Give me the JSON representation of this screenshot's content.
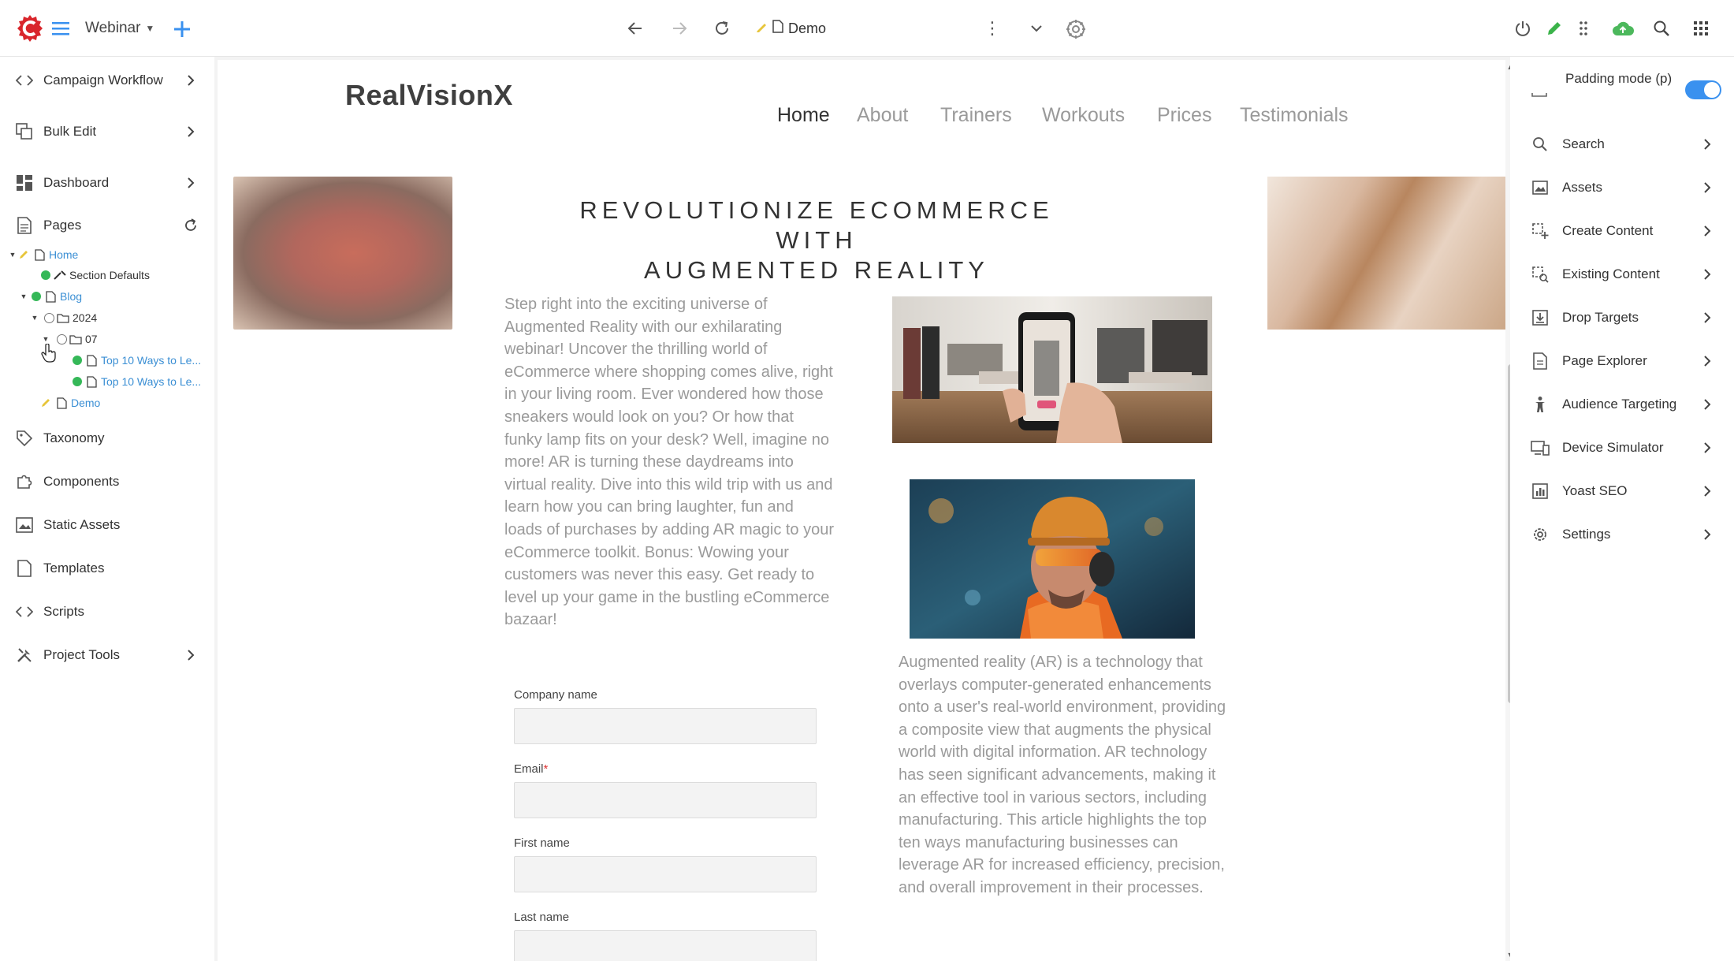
{
  "topbar": {
    "site_name": "Webinar",
    "url_page": "Demo",
    "url_more": "⋮"
  },
  "sidebar": {
    "items": [
      {
        "label": "Campaign Workflow"
      },
      {
        "label": "Bulk Edit"
      },
      {
        "label": "Dashboard"
      },
      {
        "label": "Pages"
      },
      {
        "label": "Taxonomy"
      },
      {
        "label": "Components"
      },
      {
        "label": "Static Assets"
      },
      {
        "label": "Templates"
      },
      {
        "label": "Scripts"
      },
      {
        "label": "Project Tools"
      }
    ],
    "tree": [
      {
        "label": "Home"
      },
      {
        "label": "Section Defaults"
      },
      {
        "label": "Blog"
      },
      {
        "label": "2024"
      },
      {
        "label": "07"
      },
      {
        "label": "Top 10 Ways to Le..."
      },
      {
        "label": "Top 10 Ways to Le..."
      },
      {
        "label": "Demo"
      }
    ]
  },
  "site": {
    "brand": "RealVisionX",
    "nav": [
      "Home",
      "About",
      "Trainers",
      "Workouts",
      "Prices",
      "Testimonials"
    ],
    "hero_title_line1": "REVOLUTIONIZE ECOMMERCE WITH",
    "hero_title_line2": "AUGMENTED REALITY",
    "intro_text": "Step right into the exciting universe of Augmented Reality with our exhilarating webinar! Uncover the thrilling world of eCommerce where shopping comes alive, right in your living room. Ever wondered how those sneakers would look on you? Or how that funky lamp fits on your desk? Well, imagine no more! AR is turning these daydreams into virtual reality. Dive into this wild trip with us and learn how you can bring laughter, fun and loads of purchases by adding AR magic to your eCommerce toolkit. Bonus: Wowing your customers was never this easy. Get ready to level up your game in the bustling eCommerce bazaar!",
    "ar_text": "Augmented reality (AR) is a technology that overlays computer-generated enhancements onto a user's real-world environment, providing a composite view that augments the physical world with digital information. AR technology has seen significant advancements, making it an effective tool in various sectors, including manufacturing. This article highlights the top ten ways manufacturing businesses can leverage AR for increased efficiency, precision, and overall improvement in their processes.",
    "form": {
      "company_label": "Company name",
      "email_label": "Email",
      "email_required": "*",
      "first_label": "First name",
      "last_label": "Last name"
    }
  },
  "rpanel": {
    "padding_mode": "Padding mode (p)",
    "padding_on": true,
    "items": [
      {
        "label": "Search"
      },
      {
        "label": "Assets"
      },
      {
        "label": "Create Content"
      },
      {
        "label": "Existing Content"
      },
      {
        "label": "Drop Targets"
      },
      {
        "label": "Page Explorer"
      },
      {
        "label": "Audience Targeting"
      },
      {
        "label": "Device Simulator"
      },
      {
        "label": "Yoast SEO"
      },
      {
        "label": "Settings"
      }
    ]
  },
  "colors": {
    "accent_blue": "#3a91ef",
    "brand_red": "#d9262c",
    "status_green": "#35b858",
    "link_blue": "#3b8fd4"
  }
}
